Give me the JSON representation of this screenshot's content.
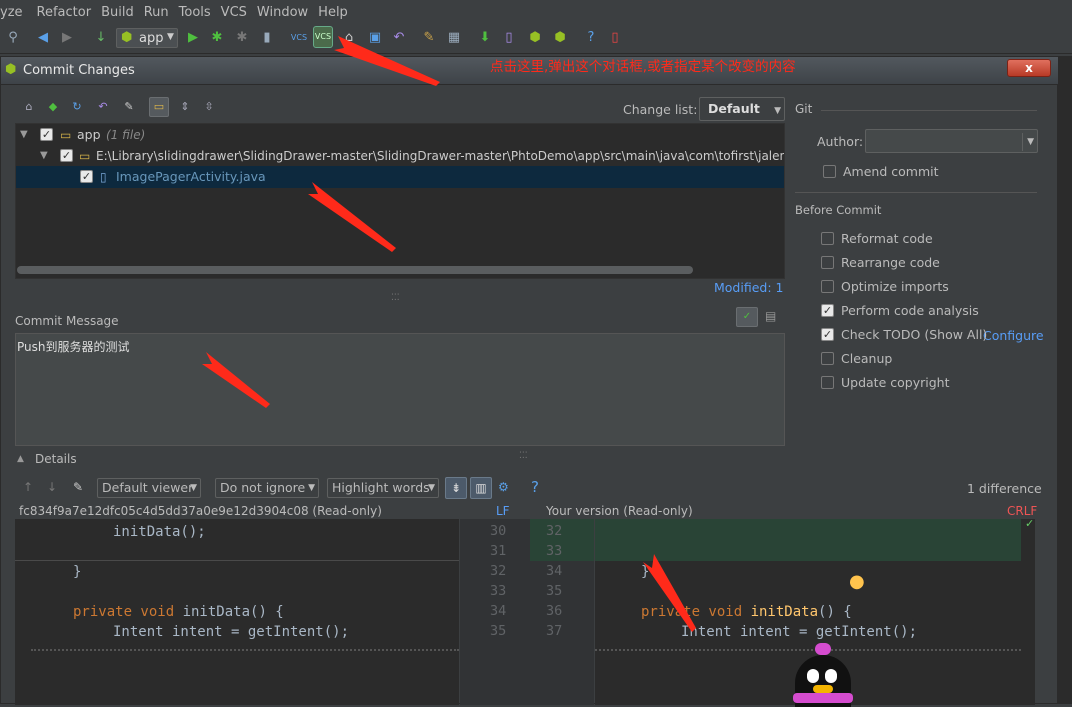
{
  "menu": [
    "yze",
    "Refactor",
    "Build",
    "Run",
    "Tools",
    "VCS",
    "Window",
    "Help"
  ],
  "toolbar": {
    "run_config": "app"
  },
  "annotation": "点击这里,弹出这个对话框,或者指定某个改变的内容",
  "dialog": {
    "title": "Commit Changes",
    "close": "x",
    "changelist_label": "Change list:",
    "changelist_value": "Default",
    "tree": {
      "root": "app",
      "root_count": "(1 file)",
      "path": "E:\\Library\\slidingdrawer\\SlidingDrawer-master\\SlidingDrawer-master\\PhtoDemo\\app\\src\\main\\java\\com\\tofirst\\jalen\\p",
      "file": "ImagePagerActivity.java"
    },
    "modified": "Modified: 1",
    "commit_message_label": "Commit Message",
    "commit_message": "Push到服务器的测试",
    "git": {
      "section": "Git",
      "author_label": "Author:",
      "author_value": "",
      "amend": "Amend commit"
    },
    "before_commit": {
      "section": "Before Commit",
      "items": [
        {
          "label": "Reformat code",
          "checked": false
        },
        {
          "label": "Rearrange code",
          "checked": false
        },
        {
          "label": "Optimize imports",
          "checked": false
        },
        {
          "label": "Perform code analysis",
          "checked": true
        },
        {
          "label": "Check TODO (Show All)",
          "checked": true
        },
        {
          "label": "Cleanup",
          "checked": false
        },
        {
          "label": "Update copyright",
          "checked": false
        }
      ],
      "configure": "Configure"
    },
    "details": {
      "label": "Details",
      "viewer": "Default viewer",
      "ignore": "Do not ignore",
      "highlight": "Highlight words",
      "difference_count": "1 difference",
      "left_title": "fc834f9a7e12dfc05c4d5dd37a0e9e12d3904c08 (Read-only)",
      "left_le": "LF",
      "right_title": "Your version (Read-only)",
      "right_le": "CRLF",
      "left_nums": [
        "30",
        "31",
        "32",
        "33",
        "34",
        "35"
      ],
      "right_nums": [
        "32",
        "33",
        "34",
        "35",
        "36",
        "37"
      ]
    }
  },
  "colors": {
    "accent_link": "#589df6",
    "annotation_red": "#ff2a1a",
    "diff_added": "#294436"
  }
}
